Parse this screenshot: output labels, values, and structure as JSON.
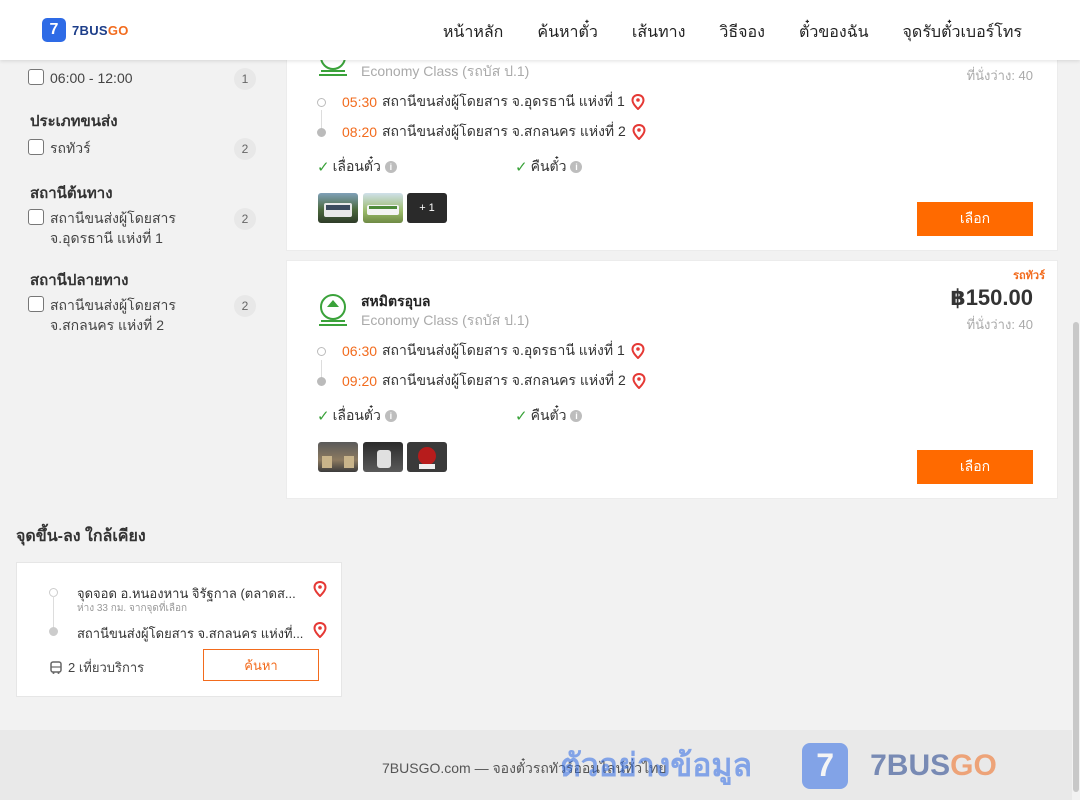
{
  "header": {
    "logo_mark": "7",
    "logo_brand": "7BUS",
    "logo_brand_accent": "GO",
    "nav": [
      "หน้าหลัก",
      "ค้นหาตั๋ว",
      "เส้นทาง",
      "วิธีจอง",
      "ตั๋วของฉัน",
      "จุดรับตั๋วเบอร์โทร"
    ]
  },
  "filters": {
    "time_option": {
      "label": "06:00 - 12:00",
      "count": "1"
    },
    "transport_type": {
      "heading": "ประเภทขนส่ง",
      "label": "รถทัวร์",
      "count": "2"
    },
    "origin": {
      "heading": "สถานีต้นทาง",
      "label_line1": "สถานีขนส่งผู้โดยสาร",
      "label_line2": "จ.อุดรธานี แห่งที่ 1",
      "count": "2"
    },
    "destination": {
      "heading": "สถานีปลายทาง",
      "label_line1": "สถานีขนส่งผู้โดยสาร",
      "label_line2": "จ.สกลนคร แห่งที่ 2",
      "count": "2"
    }
  },
  "trips": [
    {
      "class": "Economy Class (รถบัส ป.1)",
      "seats": "ที่นั่งว่าง: 40",
      "depart_time": "05:30",
      "depart_place": "สถานีขนส่งผู้โดยสาร จ.อุดรธานี แห่งที่ 1",
      "arrive_time": "08:20",
      "arrive_place": "สถานีขนส่งผู้โดยสาร จ.สกลนคร แห่งที่ 2",
      "feature_1": "เลื่อนตั๋ว",
      "feature_2": "คืนตั๋ว",
      "more_photos": "+ 1",
      "select_label": "เลือก"
    },
    {
      "badge": "รถทัวร์",
      "operator": "สหมิตรอุบล",
      "class": "Economy Class (รถบัส ป.1)",
      "price": "฿150.00",
      "seats": "ที่นั่งว่าง: 40",
      "depart_time": "06:30",
      "depart_place": "สถานีขนส่งผู้โดยสาร จ.อุดรธานี แห่งที่ 1",
      "arrive_time": "09:20",
      "arrive_place": "สถานีขนส่งผู้โดยสาร จ.สกลนคร แห่งที่ 2",
      "feature_1": "เลื่อนตั๋ว",
      "feature_2": "คืนตั๋ว",
      "select_label": "เลือก"
    }
  ],
  "nearby": {
    "title": "จุดขึ้น-ลง ใกล้เคียง",
    "from": "จุดจอด อ.หนองหาน จิรัฐกาล (ตลาดส...",
    "from_note": "ห่าง 33 กม. จากจุดที่เลือก",
    "to": "สถานีขนส่งผู้โดยสาร จ.สกลนคร แห่งที่...",
    "trips": "2 เที่ยวบริการ",
    "search_label": "ค้นหา"
  },
  "footer": {
    "text": "7BUSGO.com — จองตั๋วรถทัวร์ออนไลน์ทั่วไทย",
    "watermark_text": "ตัวอย่างข้อมูล",
    "watermark_mark": "7",
    "watermark_brand": "7BUS",
    "watermark_brand_accent": "GO"
  },
  "colors": {
    "accent": "#ff6a00",
    "brand_blue": "#2e6be6",
    "pin_red": "#e53935",
    "check_green": "#3aa23a"
  },
  "icons": [
    "operator-emblem-icon",
    "map-pin-icon",
    "check-icon",
    "info-icon",
    "bus-icon"
  ]
}
